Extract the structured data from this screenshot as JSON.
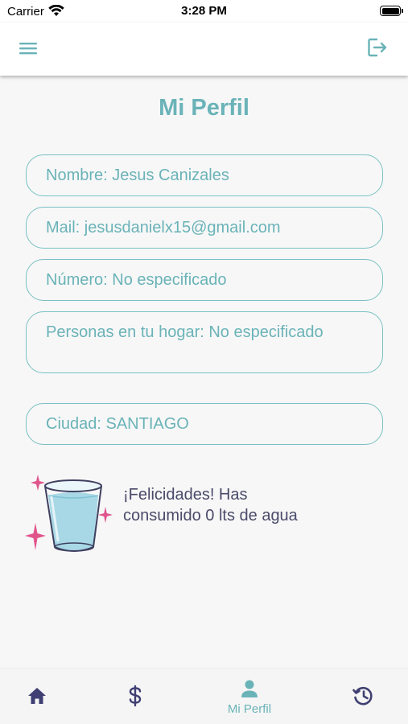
{
  "status_bar": {
    "carrier": "Carrier",
    "time": "3:28 PM"
  },
  "header": {
    "menu_icon": "hamburger-menu-icon",
    "logout_icon": "logout-icon"
  },
  "page_title": "Mi Perfil",
  "fields": {
    "nombre": "Nombre: Jesus Canizales",
    "mail": "Mail: jesusdanielx15@gmail.com",
    "numero": "Número: No especificado",
    "personas": "Personas en tu hogar: No especificado",
    "ciudad": "Ciudad: SANTIAGO"
  },
  "congrats": {
    "image": "water-glass-sparkles",
    "text": "¡Felicidades! Has consumido 0 lts de agua"
  },
  "bottom_nav": {
    "items": [
      {
        "icon": "home-icon",
        "label": ""
      },
      {
        "icon": "dollar-icon",
        "label": ""
      },
      {
        "icon": "person-icon",
        "label": "Mi Perfil",
        "active": true
      },
      {
        "icon": "history-icon",
        "label": ""
      }
    ]
  },
  "colors": {
    "accent": "#6ab3b8",
    "border": "#79c1c3",
    "nav_icon": "#3f3f73",
    "sparkle": "#e0548c",
    "text_dark": "#4a4a6a"
  }
}
